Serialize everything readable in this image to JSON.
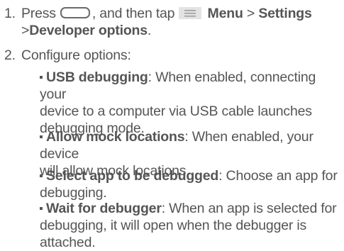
{
  "steps": [
    {
      "number": "1.",
      "text_press": "Press",
      "text_then_tap": ", and then tap",
      "menu_label": "Menu",
      "gt1": ">",
      "settings_label": "Settings",
      "gt2": ">",
      "developer_options_label": "Developer options",
      "period": ".",
      "icons": [
        "home-key-icon",
        "menu-key-icon"
      ]
    },
    {
      "number": "2.",
      "text": "Configure options:"
    }
  ],
  "options": [
    {
      "title": "USB debugging",
      "line1_rest": ": When enabled, connecting your",
      "line2": "device to a computer via USB cable launches",
      "line3": "debugging mode."
    },
    {
      "title": "Allow mock locations",
      "line1_rest": ": When enabled, your device",
      "line2": "will allow mock locations."
    },
    {
      "title": "Select app to be debugged",
      "line1_rest": ": Choose an app for",
      "line2": "debugging."
    },
    {
      "title": "Wait for debugger",
      "line1_rest": ": When an app is selected for",
      "line2": "debugging, it will open when the debugger is",
      "line3": "attached."
    }
  ]
}
